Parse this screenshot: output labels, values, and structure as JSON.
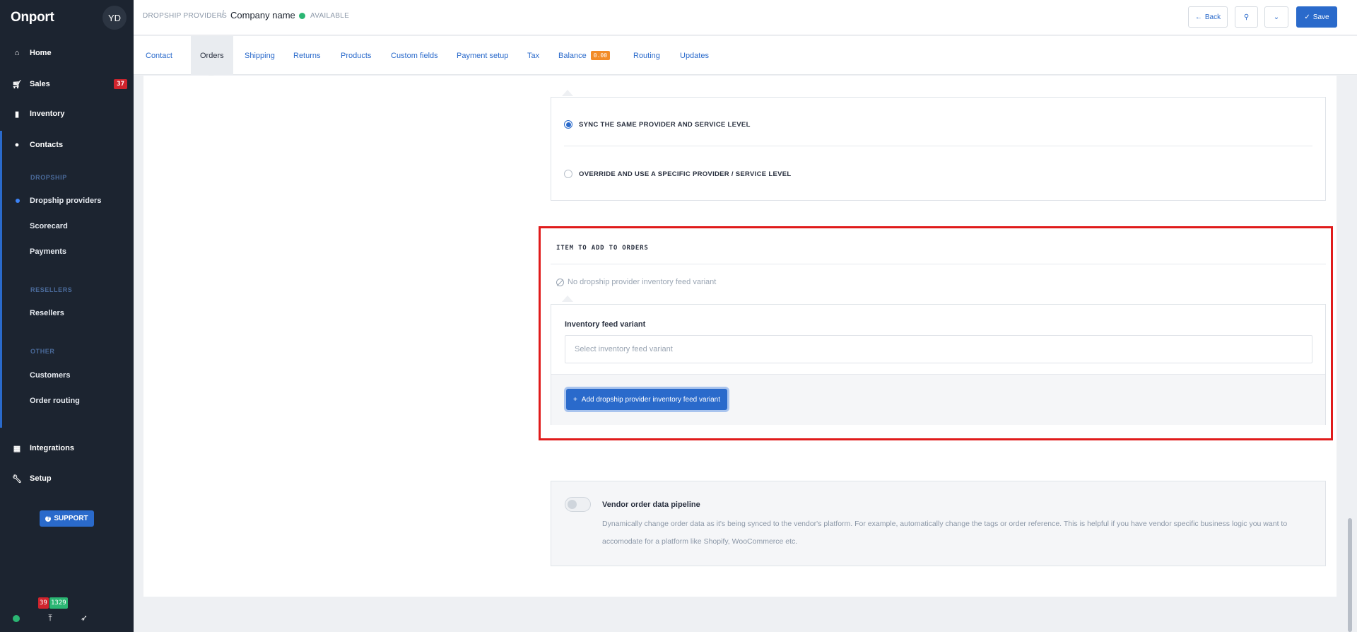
{
  "sidebar": {
    "brand": "Onport",
    "avatar": "YD",
    "nav": [
      {
        "label": "Home",
        "icon": "home-icon"
      },
      {
        "label": "Sales",
        "icon": "cart-icon",
        "badge": "37"
      },
      {
        "label": "Inventory",
        "icon": "bookmark-icon"
      },
      {
        "label": "Contacts",
        "icon": "person-icon"
      }
    ],
    "sections": [
      {
        "title": "DROPSHIP",
        "items": [
          "Dropship providers",
          "Scorecard",
          "Payments"
        ]
      },
      {
        "title": "RESELLERS",
        "items": [
          "Resellers"
        ]
      },
      {
        "title": "OTHER",
        "items": [
          "Customers",
          "Order routing"
        ]
      }
    ],
    "bottom_nav": [
      {
        "label": "Integrations",
        "icon": "grid-icon"
      },
      {
        "label": "Setup",
        "icon": "wrench-icon"
      }
    ],
    "support_label": "SUPPORT",
    "footer_badges": {
      "red": "39",
      "green": "1329"
    },
    "colors": {
      "bg": "#1c2430",
      "accent": "#2a6acb",
      "badge_red": "#d0242d",
      "badge_green": "#2bb673"
    }
  },
  "header": {
    "breadcrumb": "DROPSHIP PROVIDERS",
    "company": "Company name",
    "status": "AVAILABLE",
    "back_label": "Back",
    "save_label": "Save"
  },
  "tabs": [
    {
      "label": "Contact"
    },
    {
      "label": "Orders",
      "active": true
    },
    {
      "label": "Shipping"
    },
    {
      "label": "Returns"
    },
    {
      "label": "Products"
    },
    {
      "label": "Custom fields"
    },
    {
      "label": "Payment setup"
    },
    {
      "label": "Tax"
    },
    {
      "label": "Balance",
      "badge": "0.00"
    },
    {
      "label": "Routing"
    },
    {
      "label": "Updates"
    }
  ],
  "shipping_sync": {
    "option_same": "SYNC THE SAME PROVIDER AND SERVICE LEVEL",
    "option_override": "OVERRIDE AND USE A SPECIFIC PROVIDER / SERVICE LEVEL",
    "selected": "same"
  },
  "item_to_add": {
    "title": "ITEM TO ADD TO ORDERS",
    "empty_note": "No dropship provider inventory feed variant",
    "field_label": "Inventory feed variant",
    "field_placeholder": "Select inventory feed variant",
    "add_button": "Add dropship provider inventory feed variant"
  },
  "pipeline": {
    "title": "Vendor order data pipeline",
    "description": "Dynamically change order data as it's being synced to the vendor's platform. For example, automatically change the tags or order reference. This is helpful if you have vendor specific business logic you want to accomodate for a platform like Shopify, WooCommerce etc.",
    "enabled": false
  }
}
